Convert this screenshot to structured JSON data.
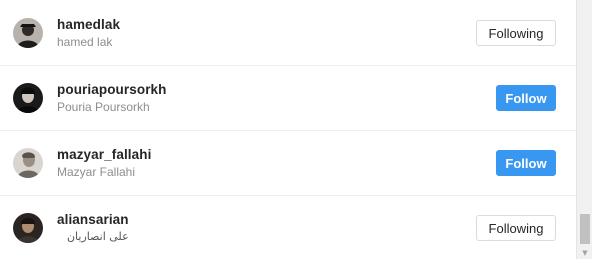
{
  "users": [
    {
      "username": "hamedlak",
      "full_name": "hamed lak",
      "button_label": "Following",
      "state": "following",
      "avatar": "avatar-dark-hat"
    },
    {
      "username": "pouriapoursorkh",
      "full_name": "Pouria Poursorkh",
      "button_label": "Follow",
      "state": "follow",
      "avatar": "avatar-dark-portrait"
    },
    {
      "username": "mazyar_fallahi",
      "full_name": "Mazyar Fallahi",
      "button_label": "Follow",
      "state": "follow",
      "avatar": "avatar-grey-portrait"
    },
    {
      "username": "aliansarian",
      "full_name": "علی انصاریان",
      "button_label": "Following",
      "state": "following",
      "avatar": "avatar-dark-portrait"
    }
  ],
  "colors": {
    "follow_button_bg": "#3897f0",
    "following_button_border": "#dbdbdb",
    "username_text": "#262626",
    "fullname_text": "#8e8e8e"
  },
  "scrollbar": {
    "down_arrow_icon": "chevron-down-icon"
  }
}
